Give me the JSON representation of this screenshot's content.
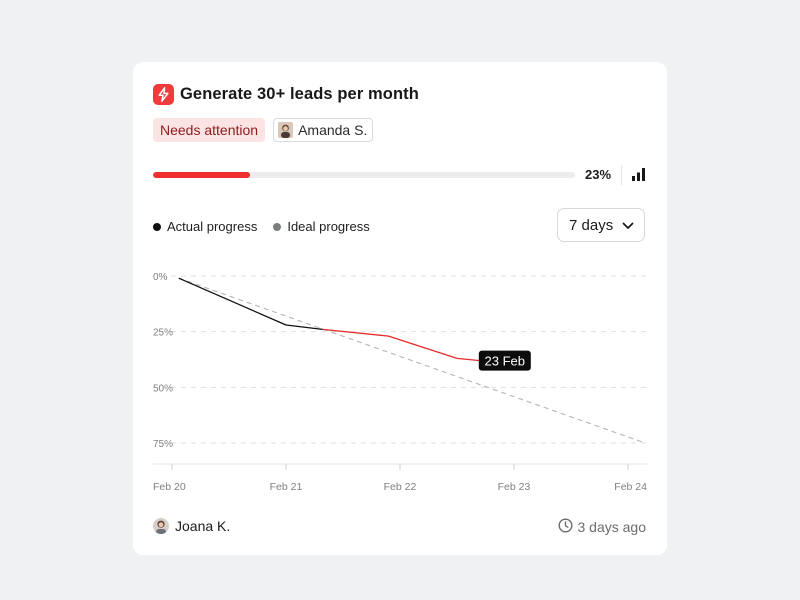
{
  "goal": {
    "title": "Generate 30+ leads per month",
    "status": "Needs attention",
    "assignee": "Amanda S.",
    "progress_percent": 23,
    "progress_label": "23%"
  },
  "legend": {
    "actual": "Actual progress",
    "ideal": "Ideal progress"
  },
  "period_select": {
    "value": "7 days"
  },
  "chart_data": {
    "type": "line",
    "y_tick_labels": [
      "0%",
      "25%",
      "50%",
      "75%"
    ],
    "x_tick_labels": [
      "Feb 20",
      "Feb 21",
      "Feb 22",
      "Feb 23",
      "Feb 24"
    ],
    "x": [
      0,
      1,
      2,
      3,
      4
    ],
    "ylim": [
      0,
      75
    ],
    "y_inverted": true,
    "grid": true,
    "series": [
      {
        "name": "Actual progress",
        "color": "#111111",
        "points": [
          [
            0.06,
            1
          ],
          [
            1.0,
            22
          ],
          [
            1.32,
            24
          ]
        ]
      },
      {
        "name": "",
        "color": "#e52b2b",
        "points": [
          [
            1.32,
            24
          ],
          [
            1.9,
            27
          ],
          [
            2.5,
            37
          ],
          [
            2.7,
            38
          ]
        ]
      },
      {
        "name": "Ideal progress",
        "color": "#b8b9bc",
        "dashed": true,
        "points": [
          [
            0.06,
            1
          ],
          [
            4.15,
            75
          ]
        ]
      }
    ],
    "annotation": {
      "label": "23 Feb"
    }
  },
  "footer": {
    "owner": "Joana K.",
    "updated": "3 days ago"
  },
  "colors": {
    "accent_red": "#ef2f2f",
    "status_bg": "#fde4e4",
    "status_text": "#8a1c1c"
  },
  "icons": {
    "goal": "lightning-icon",
    "stats": "bar-chart-icon",
    "dropdown": "chevron-down-icon",
    "time": "clock-icon"
  }
}
